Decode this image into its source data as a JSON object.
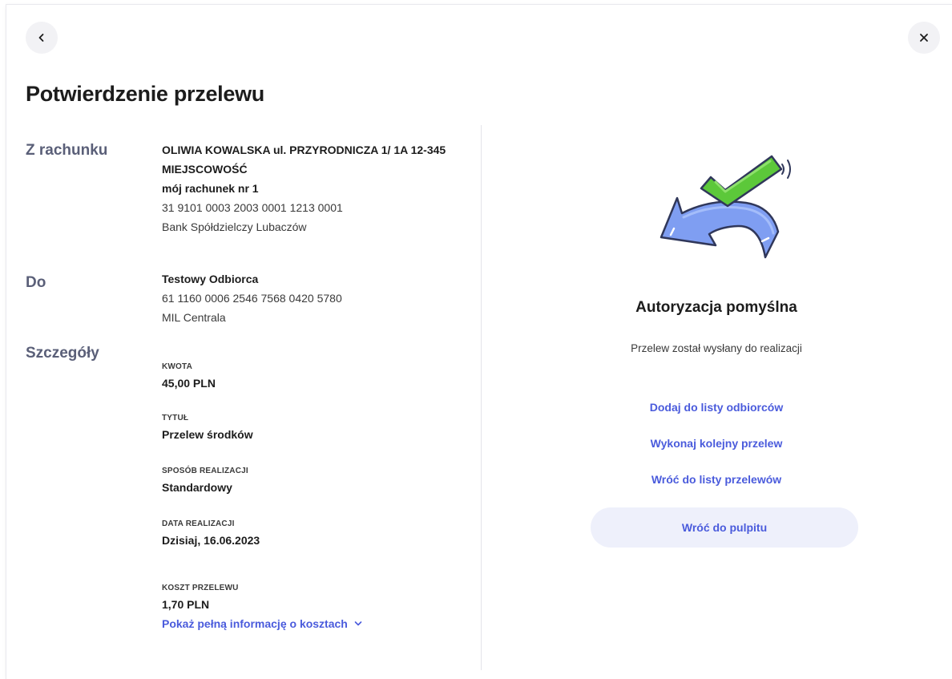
{
  "header": {
    "title": "Potwierdzenie przelewu",
    "back_icon": "chevron-left-icon",
    "close_icon": "close-icon"
  },
  "from": {
    "label": "Z rachunku",
    "owner_line1": "OLIWIA KOWALSKA ul. PRZYRODNICZA 1/ 1A 12-345",
    "owner_line2": "MIEJSCOWOŚĆ",
    "account_name": "mój rachunek nr 1",
    "account_number": "31 9101 0003 2003 0001 1213 0001",
    "bank": "Bank Spółdzielczy Lubaczów"
  },
  "to": {
    "label": "Do",
    "name": "Testowy Odbiorca",
    "account_number": "61 1160 0006 2546 7568 0420 5780",
    "bank": "MIL Centrala"
  },
  "details": {
    "label": "Szczegóły",
    "fields": [
      {
        "label": "KWOTA",
        "value": "45,00 PLN"
      },
      {
        "label": "TYTUŁ",
        "value": "Przelew środków"
      },
      {
        "label": "SPOSÓB REALIZACJI",
        "value": "Standardowy"
      },
      {
        "label": "DATA REALIZACJI",
        "value": "Dzisiaj, 16.06.2023"
      },
      {
        "label": "KOSZT PRZELEWU",
        "value": "1,70 PLN"
      }
    ],
    "cost_link": "Pokaż pełną informację o kosztach"
  },
  "result": {
    "title": "Autoryzacja pomyślna",
    "subtitle": "Przelew został wysłany do realizacji",
    "links": [
      "Dodaj do listy odbiorców",
      "Wykonaj kolejny przelew",
      "Wróć do listy przelewów"
    ],
    "primary_button": "Wróć do pulpitu"
  },
  "colors": {
    "accent": "#4a5bdc",
    "section_label": "#5a5f78",
    "check_green": "#5cc83a",
    "arrow_blue": "#7f9ef2"
  }
}
